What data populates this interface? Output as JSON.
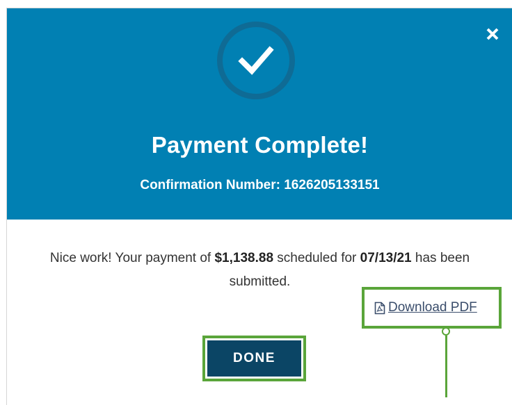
{
  "modal": {
    "title": "Payment Complete!",
    "confirmation_label": "Confirmation Number: 1626205133151",
    "close_icon": "close-icon",
    "check_icon": "checkmark-icon"
  },
  "message": {
    "part1": "Nice work! Your payment of ",
    "amount": "$1,138.88",
    "part2": " scheduled for ",
    "date": "07/13/21",
    "part3": " has been submitted."
  },
  "actions": {
    "download_label": "Download PDF",
    "download_icon": "pdf-file-icon",
    "done_label": "DONE"
  },
  "colors": {
    "header_bg": "#0180b3",
    "ring": "#0f6b95",
    "done_bg": "#0b4565",
    "highlight": "#5aa53a"
  }
}
